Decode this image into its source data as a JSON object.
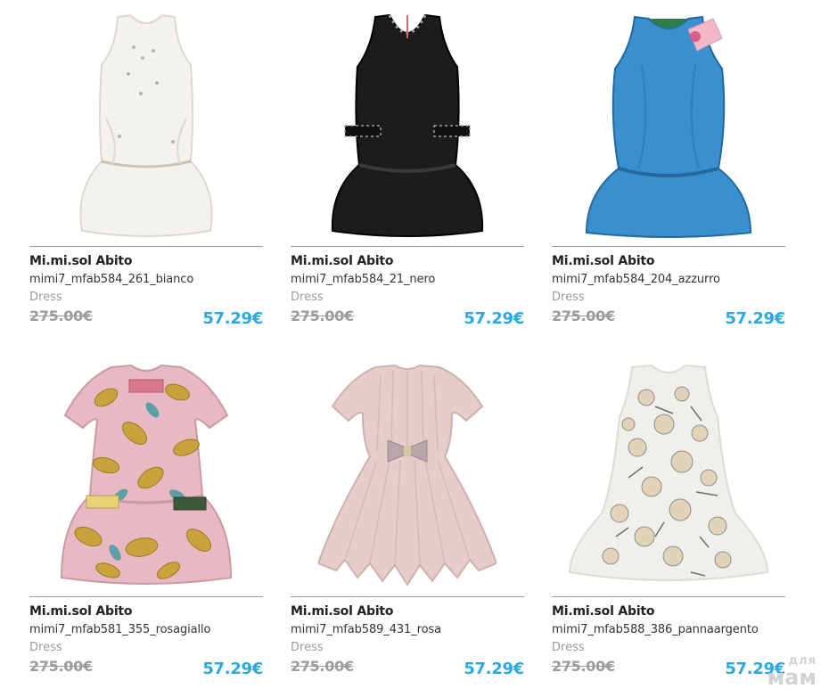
{
  "products": [
    {
      "brand": "Mi.mi.sol Abito",
      "sku": "mimi7_mfab584_261_bianco",
      "category": "Dress",
      "old_price": "275.00€",
      "new_price": "57.29€",
      "image": "dress-icon",
      "colors": {
        "main": "#f4f2ec",
        "shade": "#dcd8ce",
        "accent": "#c8c4ba"
      }
    },
    {
      "brand": "Mi.mi.sol Abito",
      "sku": "mimi7_mfab584_21_nero",
      "category": "Dress",
      "old_price": "275.00€",
      "new_price": "57.29€",
      "image": "dress-icon",
      "colors": {
        "main": "#1c1c1c",
        "shade": "#000000",
        "accent": "#9aa0a8"
      }
    },
    {
      "brand": "Mi.mi.sol Abito",
      "sku": "mimi7_mfab584_204_azzurro",
      "category": "Dress",
      "old_price": "275.00€",
      "new_price": "57.29€",
      "image": "dress-icon",
      "colors": {
        "main": "#3a8fcf",
        "shade": "#23699f",
        "accent": "#f2b8c6"
      }
    },
    {
      "brand": "Mi.mi.sol Abito",
      "sku": "mimi7_mfab581_355_rosagiallo",
      "category": "Dress",
      "old_price": "275.00€",
      "new_price": "57.29€",
      "image": "dress-icon",
      "colors": {
        "main": "#e8b9c2",
        "shade": "#c9a23c",
        "accent": "#5e9ea6"
      }
    },
    {
      "brand": "Mi.mi.sol Abito",
      "sku": "mimi7_mfab589_431_rosa",
      "category": "Dress",
      "old_price": "275.00€",
      "new_price": "57.29€",
      "image": "dress-icon",
      "colors": {
        "main": "#e6cdca",
        "shade": "#cfb0ad",
        "accent": "#b9a5aa"
      }
    },
    {
      "brand": "Mi.mi.sol Abito",
      "sku": "mimi7_mfab588_386_pannaargento",
      "category": "Dress",
      "old_price": "275.00€",
      "new_price": "57.29€",
      "image": "dress-icon",
      "colors": {
        "main": "#f1efea",
        "shade": "#e2d2b8",
        "accent": "#8d8d8d"
      }
    }
  ],
  "watermark": {
    "top": "для",
    "bottom": "мам"
  }
}
